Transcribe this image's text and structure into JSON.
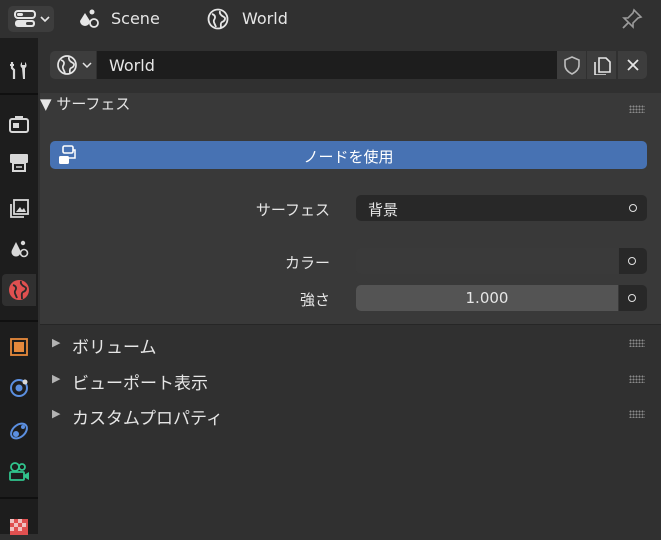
{
  "header": {
    "editor_type_icon": "properties-editor-icon",
    "scene_icon": "scene-icon",
    "scene_label": "Scene",
    "world_icon": "world-icon",
    "world_label": "World",
    "pin_icon": "pin-icon"
  },
  "tabs": [
    {
      "name": "tool",
      "icon": "wrench-screwdriver-icon"
    },
    {
      "name": "render",
      "icon": "camera-back-icon"
    },
    {
      "name": "output",
      "icon": "printer-icon"
    },
    {
      "name": "view-layer",
      "icon": "image-stack-icon"
    },
    {
      "name": "scene",
      "icon": "scene-icon"
    },
    {
      "name": "world",
      "icon": "world-icon",
      "active": true
    },
    {
      "name": "object",
      "icon": "object-square-icon"
    },
    {
      "name": "modifiers",
      "icon": "physics-icon"
    },
    {
      "name": "constraints",
      "icon": "constraint-icon"
    },
    {
      "name": "data",
      "icon": "camera-data-icon"
    },
    {
      "name": "texture",
      "icon": "checker-icon"
    }
  ],
  "world_selector": {
    "value": "World",
    "fake_user_icon": "shield-icon",
    "duplicate_icon": "duplicate-icon",
    "unlink_icon": "close-icon"
  },
  "panels": {
    "surface": {
      "title": "サーフェス",
      "use_nodes_label": "ノードを使用",
      "surface_label": "サーフェス",
      "surface_value": "背景",
      "color_label": "カラー",
      "strength_label": "強さ",
      "strength_value": "1.000"
    },
    "volume": {
      "title": "ボリューム"
    },
    "viewport": {
      "title": "ビューポート表示"
    },
    "custom": {
      "title": "カスタムプロパティ"
    }
  },
  "colors": {
    "accent": "#4772b3",
    "active_tab_icon": "#e05050",
    "object_icon": "#e6893c",
    "physics_icon": "#5b8fe0",
    "data_icon": "#31c48d"
  }
}
